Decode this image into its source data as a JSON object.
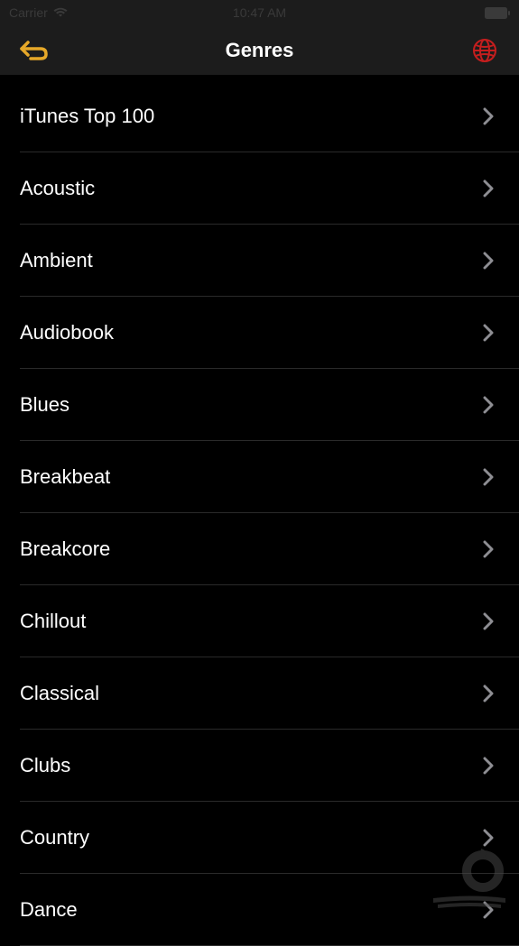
{
  "status_bar": {
    "carrier": "Carrier",
    "time": "10:47 AM"
  },
  "nav": {
    "title": "Genres"
  },
  "genres": [
    {
      "label": "iTunes Top 100"
    },
    {
      "label": "Acoustic"
    },
    {
      "label": "Ambient"
    },
    {
      "label": "Audiobook"
    },
    {
      "label": "Blues"
    },
    {
      "label": "Breakbeat"
    },
    {
      "label": "Breakcore"
    },
    {
      "label": "Chillout"
    },
    {
      "label": "Classical"
    },
    {
      "label": "Clubs"
    },
    {
      "label": "Country"
    },
    {
      "label": "Dance"
    }
  ]
}
